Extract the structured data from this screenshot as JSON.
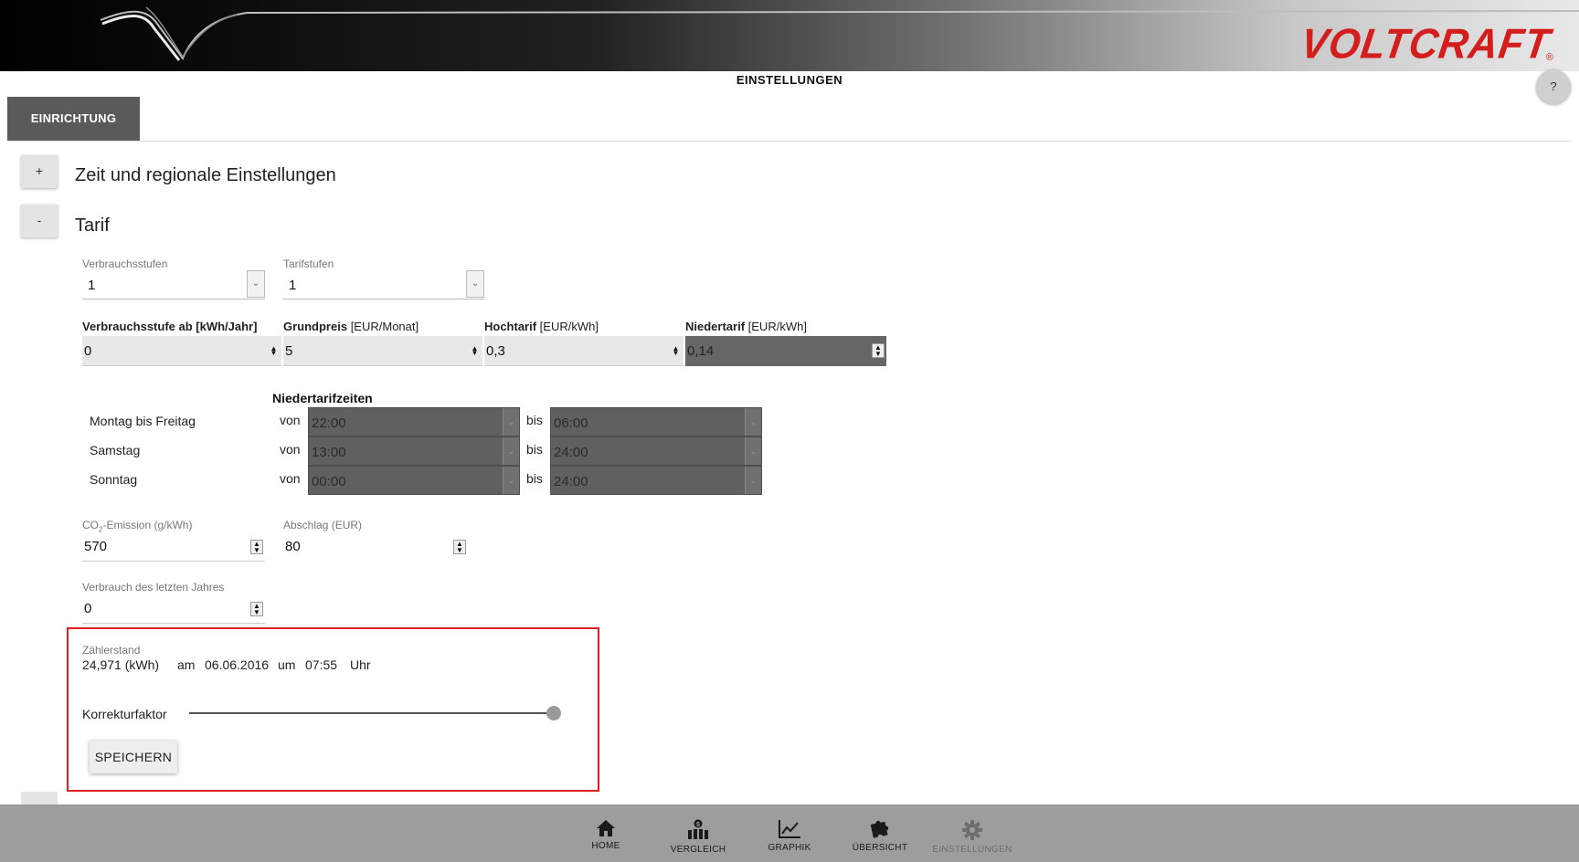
{
  "header": {
    "brand": "VOLTCRAFT",
    "brand_mark": "®",
    "page_title": "EINSTELLUNGEN",
    "help_label": "?"
  },
  "tabs": [
    {
      "label": "EINRICHTUNG",
      "active": true
    }
  ],
  "sections": {
    "regional": {
      "toggle": "+",
      "title": "Zeit und regionale Einstellungen"
    },
    "tarif": {
      "toggle": "-",
      "title": "Tarif"
    }
  },
  "tarif": {
    "verbrauchsstufen": {
      "label": "Verbrauchsstufen",
      "value": "1"
    },
    "tarifstufen": {
      "label": "Tarifstufen",
      "value": "1"
    },
    "columns": [
      {
        "bold": "Verbrauchsstufe ab [kWh/Jahr]",
        "unit": "",
        "value": "0"
      },
      {
        "bold": "Grundpreis",
        "unit": " [EUR/Monat]",
        "value": "5"
      },
      {
        "bold": "Hochtarif",
        "unit": " [EUR/kWh]",
        "value": "0,3"
      },
      {
        "bold": "Niedertarif",
        "unit": " [EUR/kWh]",
        "value": "0,14"
      }
    ],
    "niedertarifzeiten": {
      "title": "Niedertarifzeiten",
      "von_label": "von",
      "bis_label": "bis",
      "rows": [
        {
          "day": "Montag bis Freitag",
          "from": "22:00",
          "to": "06:00"
        },
        {
          "day": "Samstag",
          "from": "13:00",
          "to": "24:00"
        },
        {
          "day": "Sonntag",
          "from": "00:00",
          "to": "24:00"
        }
      ]
    },
    "co2": {
      "label_prefix": "CO",
      "label_sub": "2",
      "label_suffix": "-Emission (g/kWh)",
      "value": "570"
    },
    "abschlag": {
      "label": "Abschlag (EUR)",
      "value": "80"
    },
    "verbrauch": {
      "label": "Verbrauch des letzten Jahres",
      "value": "0"
    },
    "zaehlerstand": {
      "label": "Zählerstand",
      "value": "24,971 (kWh)",
      "am_label": "am",
      "date": "06.06.2016",
      "um_label": "um",
      "time": "07:55",
      "uhr_label": "Uhr"
    },
    "korrekturfaktor": {
      "label": "Korrekturfaktor",
      "level": 1.0
    },
    "save_label": "SPEICHERN"
  },
  "bottom_nav": [
    {
      "label": "HOME",
      "icon": "home-icon",
      "enabled": true
    },
    {
      "label": "VERGLEICH",
      "icon": "compare-icon",
      "enabled": true
    },
    {
      "label": "GRAPHIK",
      "icon": "chart-icon",
      "enabled": true
    },
    {
      "label": "ÜBERSICHT",
      "icon": "puzzle-icon",
      "enabled": true
    },
    {
      "label": "EINSTELLUNGEN",
      "icon": "gear-icon",
      "enabled": false
    }
  ],
  "colors": {
    "brand": "#d41e1e",
    "tab_bg": "#5a5a5a",
    "highlight_border": "#e02020",
    "nav_bg": "#9d9d9d"
  }
}
